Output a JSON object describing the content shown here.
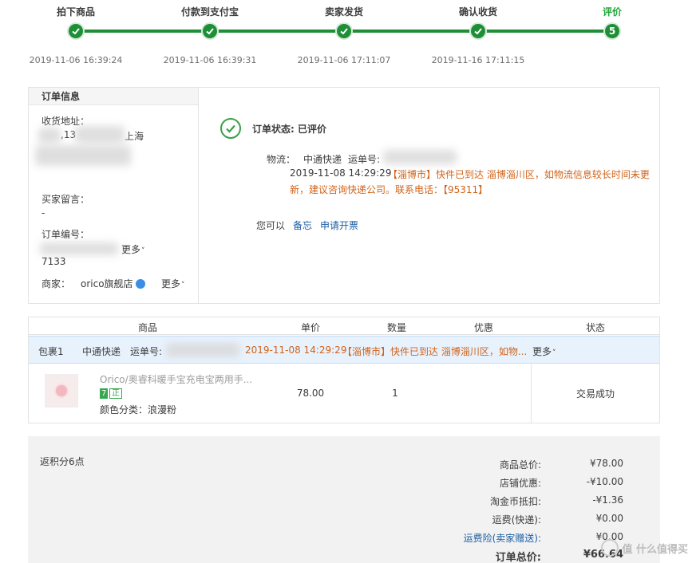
{
  "steps": [
    {
      "title": "拍下商品",
      "time": "2019-11-06 16:39:24"
    },
    {
      "title": "付款到支付宝",
      "time": "2019-11-06 16:39:31"
    },
    {
      "title": "卖家发货",
      "time": "2019-11-06 17:11:07"
    },
    {
      "title": "确认收货",
      "time": "2019-11-16 17:11:15"
    },
    {
      "title": "评价",
      "time": "",
      "number": "5"
    }
  ],
  "order_info": {
    "header": "订单信息",
    "address_label": "收货地址：",
    "address_partial": ",13",
    "address_city": "上海",
    "buyer_note_label": "买家留言：",
    "buyer_note_value": "-",
    "order_no_label": "订单编号：",
    "order_no_tail": "7133",
    "more_label": "更多",
    "seller_label": "商家：",
    "seller_name": "orico旗舰店"
  },
  "status": {
    "label": "订单状态: 已评价",
    "logistics_label": "物流：",
    "carrier": "中通快递",
    "waybill_label": "运单号:",
    "update_time": "2019-11-08 14:29:29",
    "update_text_1": "【淄博市】快件已到达 淄博淄川区，如物流信息较长时间未更",
    "update_text_2": "新，建议咨询快递公司。联系电话：【95311】",
    "you_can": "您可以",
    "action_note": "备忘",
    "action_invoice": "申请开票"
  },
  "table": {
    "headers": [
      "商品",
      "单价",
      "数量",
      "优惠",
      "状态"
    ],
    "package": {
      "name": "包裹1",
      "carrier": "中通快递",
      "waybill_label": "运单号:",
      "time": "2019-11-08 14:29:29",
      "text": "【淄博市】快件已到达 淄博淄川区，如物...",
      "more": "更多"
    },
    "item": {
      "name": "Orico/奥睿科暖手宝充电宝两用手...",
      "badge_7": "7",
      "badge_z": "正",
      "spec": "颜色分类：浪漫粉",
      "price": "78.00",
      "qty": "1",
      "state": "交易成功"
    }
  },
  "totals": {
    "points": "返积分6点",
    "rows": [
      {
        "k": "商品总价:",
        "v": "¥78.00"
      },
      {
        "k": "店铺优惠:",
        "v": "-¥10.00"
      },
      {
        "k": "淘金币抵扣:",
        "v": "-¥1.36"
      },
      {
        "k": "运费(快递):",
        "v": "¥0.00"
      },
      {
        "k": "运费险(卖家赠送):",
        "v": "¥0.00"
      },
      {
        "k": "订单总价:",
        "v": "¥66.64"
      }
    ],
    "watermark": "值 什么值得买"
  },
  "colors": {
    "accent_green": "#1f8f37",
    "orange": "#d0631a",
    "link": "#1d5fa3"
  }
}
